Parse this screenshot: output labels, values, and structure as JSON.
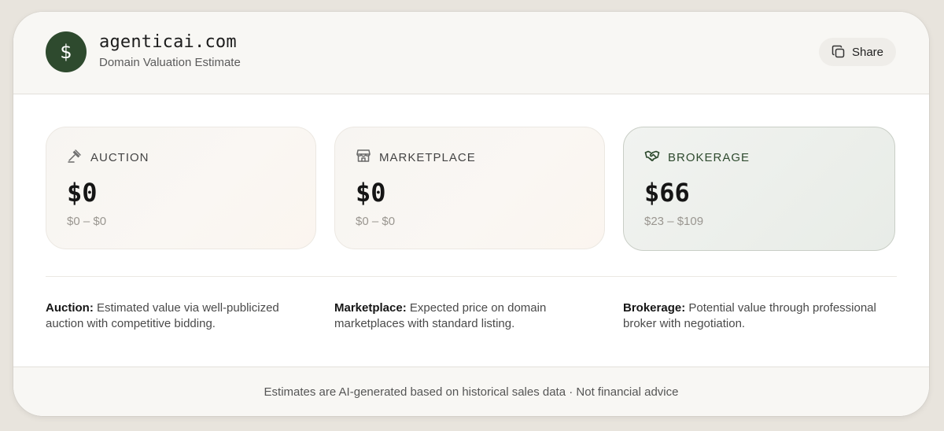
{
  "header": {
    "domain": "agenticai.com",
    "subtitle": "Domain Valuation Estimate",
    "logo_icon": "dollar-icon",
    "share_label": "Share",
    "share_icon": "copy-icon"
  },
  "colors": {
    "brand": "#2e4a2e",
    "background": "#e8e4dd"
  },
  "tiles": [
    {
      "icon": "gavel-icon",
      "label": "AUCTION",
      "value": "$0",
      "range": "$0 – $0"
    },
    {
      "icon": "store-icon",
      "label": "MARKETPLACE",
      "value": "$0",
      "range": "$0 – $0"
    },
    {
      "icon": "handshake-icon",
      "label": "BROKERAGE",
      "value": "$66",
      "range": "$23 – $109"
    }
  ],
  "descriptions": [
    {
      "term": "Auction:",
      "text": " Estimated value via well-publicized auction with competitive bidding."
    },
    {
      "term": "Marketplace:",
      "text": " Expected price on domain marketplaces with standard listing."
    },
    {
      "term": "Brokerage:",
      "text": " Potential value through professional broker with negotiation."
    }
  ],
  "footer": {
    "text": "Estimates are AI-generated based on historical sales data · Not financial advice"
  }
}
